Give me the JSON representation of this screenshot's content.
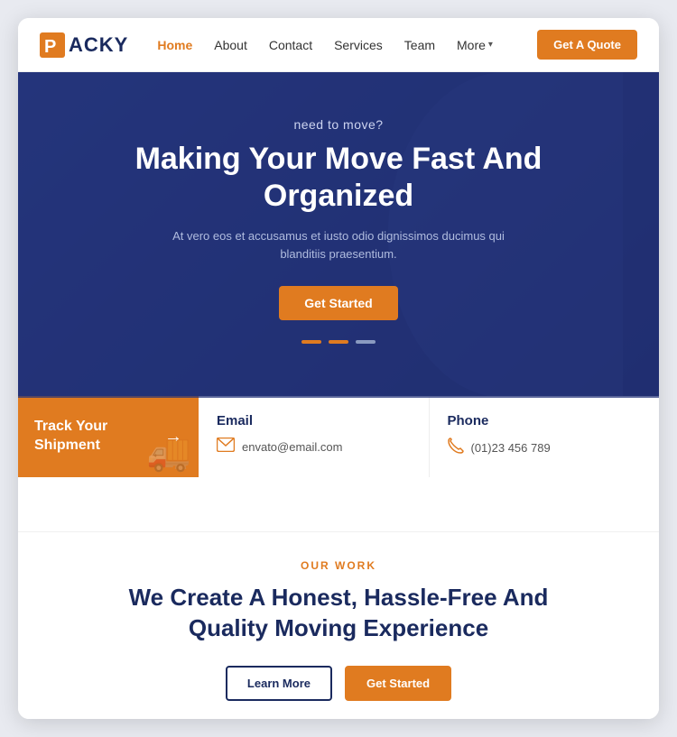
{
  "brand": {
    "name": "ACKY",
    "logo_letter": "P"
  },
  "navbar": {
    "links": [
      {
        "label": "Home",
        "active": true
      },
      {
        "label": "About",
        "active": false
      },
      {
        "label": "Contact",
        "active": false
      },
      {
        "label": "Services",
        "active": false
      },
      {
        "label": "Team",
        "active": false
      },
      {
        "label": "More",
        "has_dropdown": true
      }
    ],
    "cta_label": "Get A Quote"
  },
  "hero": {
    "sub_title": "need to move?",
    "title": "Making Your Move Fast And Organized",
    "description": "At vero eos et accusamus et iusto odio dignissimos ducimus qui blanditiis praesentium.",
    "cta_label": "Get Started",
    "dots": [
      {
        "active": true
      },
      {
        "active": true
      },
      {
        "active": false
      }
    ]
  },
  "track_card": {
    "label_line1": "Track Your",
    "label_line2": "Shipment",
    "arrow": "→",
    "icon": "🚚"
  },
  "contact_cards": [
    {
      "title": "Email",
      "icon": "✉",
      "value": "envato@email.com"
    },
    {
      "title": "Phone",
      "icon": "📞",
      "value": "(01)23 456 789"
    }
  ],
  "our_work": {
    "tag": "OUR WORK",
    "title": "We Create A Honest, Hassle-Free And Quality Moving Experience",
    "btn_primary": "Learn More",
    "btn_secondary": "Get Started"
  },
  "colors": {
    "accent": "#e07b20",
    "brand_blue": "#1a2a5e",
    "hero_bg": "#2d3a7c"
  }
}
